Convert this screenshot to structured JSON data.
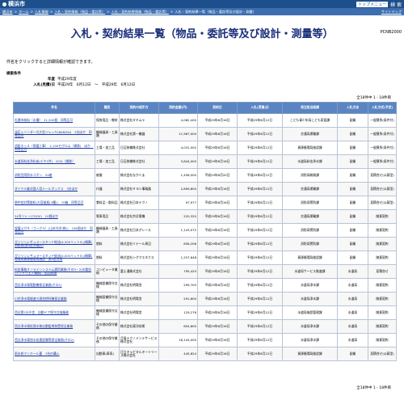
{
  "header": {
    "logo": "横浜市",
    "top_menu": "トップメニュー",
    "search": "検 索"
  },
  "breadcrumb": {
    "items": [
      "横浜市",
      "ホーム",
      "入札情報",
      "入札・契約情報（物品・委託等）",
      "入札・契約結果情報（物品・委託等）",
      "入札・契約結果一覧（物品・委託等及び設計・測量）"
    ],
    "sitemap": "サイトマップ"
  },
  "page": {
    "title": "入札・契約結果一覧（物品・委託等及び設計・測量等）",
    "code": "PCNB2000",
    "note": "件名をクリックすると詳細情報が確認できます。",
    "conditions_label": "検索条件",
    "cond_year_label": "年度",
    "cond_year_value": "平成29年度",
    "cond_date_label": "入札(見積)日",
    "cond_date_value": "平成29年　6月12日　～　平成29年　6月12日",
    "count_text": "全18件中 1 - 18件目"
  },
  "table": {
    "headers": [
      "件名",
      "種目",
      "契約の相手方",
      "契約金額(円)",
      "契約日",
      "入札(見積)日",
      "発注担当局課",
      "入札方法",
      "入札方式(予定)"
    ],
    "rows": [
      [
        "札幌市給料（水槽）　21,500個　同等品可",
        "保育用品・教材",
        "株式会社タチムラ",
        "4,082,400",
        "平成29年6月16日",
        "平成29年6月12日",
        "こども青少年局こども家庭課",
        "副業",
        "一般競争(条件付)"
      ],
      [
        "油圧シリンダー式大型ジャッキ(BANZAI)　2台ほか　同等品可",
        "機械器具・工具類",
        "株式会社第一機器",
        "11,967,000",
        "平成29年6月16日",
        "平成29年6月12日",
        "交通局運輸課",
        "副業",
        "一般競争(条件付)"
      ],
      [
        "消防ホース（保護工事）　2,100セグロム（鋼鉄)　ほか　同等品可",
        "工場・加工品",
        "日辺装備株式会社",
        "4,031,002",
        "平成29年6月16日",
        "平成29年6月12日",
        "資源循環局施設課",
        "副業",
        "一般競争(条件付)"
      ],
      [
        "水道局料金浄化炭(デキ1件)　201t（鋼鉄）",
        "工場・加工品",
        "日辺装備株式会社",
        "3,844,000",
        "平成29年6月16日",
        "平成29年6月12日",
        "水道局料金浄水課",
        "副業",
        "一般競争(条件付)"
      ],
      [
        "消防団用防水ゴボン　54着",
        "被服",
        "株式会社なかぐま",
        "1,458,000",
        "平成29年6月20日",
        "平成29年6月12日",
        "消防局総務課",
        "副業",
        "見積合せ(公募型)"
      ],
      [
        "ダイヤル継式個人用メールボックス　3台ほか",
        "什器",
        "株式会社ミヨシ事務器",
        "2,899,800",
        "平成29年6月16日",
        "平成29年6月12日",
        "交通局運輸課",
        "副業",
        "見積合せ(公募型)"
      ],
      [
        "熱中症対策飲料(大容量瓶(3種))　70箱　同等品可",
        "食料品・飲料品",
        "株式会社日本テクノ",
        "97,977",
        "平成29年6月16日",
        "平成29年6月12日",
        "消防局警防課",
        "副業",
        "見積合せ(公募型)"
      ],
      [
        "34号リレー(7GGV)　10個ほか",
        "電車用品",
        "株式会社京浜電機",
        "220,320",
        "平成29年6月16日",
        "平成29年6月12日",
        "交通局運輸課",
        "副業",
        "随意契約"
      ],
      [
        "保護メガネ（ゴーグル）(山本光学(株))　108個ほか　同等品可",
        "機械器具・工具類",
        "株式会社日本グレース",
        "1,143,072",
        "平成29年6月16日",
        "平成29年6月12日",
        "消防局警防課",
        "副業",
        "随意契約"
      ],
      [
        "ガソリンレギュラースタンド給油(4,300リットル)(概算)消防局(第4区分検討)",
        "燃料",
        "株式会社リテール周辺",
        "656,208",
        "平成29年6月16日",
        "平成29年6月12日",
        "消防局警防課",
        "副業",
        "随意契約"
      ],
      [
        "ガソリンレギュラースタンド給油(4,000リットル)(概算)環境局資源循環局施設　第4区分局",
        "燃料",
        "株式会社シグマエネクス",
        "1,257,648",
        "平成29年6月16日",
        "平成29年6月12日",
        "資源循環局施設課",
        "副業",
        "随意契約"
      ],
      [
        "料金事務オンラインシステム運用業務(その3・2)の委託(ソフトウェア業務)　追加改造",
        "コンピュータ業務",
        "富士通株式会社",
        "795,420",
        "平成29年6月16日",
        "平成29年6月12日",
        "水道局サービス推進課",
        "水道局",
        "見積合せ"
      ],
      [
        "西谷浄水場電動機保全業務(その1)",
        "機械設備保守点検",
        "株式会社明電舎",
        "299,700",
        "平成29年6月16日",
        "平成29年6月12日",
        "水道局浄水課",
        "水道局",
        "随意契約"
      ],
      [
        "川井浄水場緩速ろ過池撹拌機保全業務",
        "機械設備保守点検",
        "株式会社明電舎",
        "291,600",
        "平成29年6月16日",
        "平成29年6月12日",
        "水道局浄水課",
        "水道局",
        "随意契約"
      ],
      [
        "西谷第2分庁舎　自動ドア保守点検業務",
        "機械設備保守点検",
        "株式会社明電舎",
        "129,276",
        "平成29年6月16日",
        "平成29年6月12日",
        "水道局施設管理課",
        "水道局",
        "随意契約"
      ],
      [
        "西谷浄水場処理水質自動監視装置保全業務",
        "その他の保守業務",
        "株式会社東洋技術",
        "604,800",
        "平成29年6月16日",
        "平成29年6月12日",
        "水道局浄水課",
        "水道局",
        "随意契約"
      ],
      [
        "西谷浄水場排水処理設備等保全業務(その2)",
        "その他の保守業務",
        "月島テクノメンテサービス株式会社",
        "18,144,000",
        "平成29年6月16日",
        "平成29年6月12日",
        "水道局浄水課",
        "水道局",
        "随意契約"
      ],
      [
        "雨水枡マンホール蓋　3台の購入",
        "自動車(車両)",
        "日立キャピタルオートリース株式会社",
        "445,824",
        "平成29年6月16日",
        "平成29年6月12日",
        "資源循環局施設課",
        "副業",
        "見積合せ(公募型)"
      ]
    ]
  }
}
